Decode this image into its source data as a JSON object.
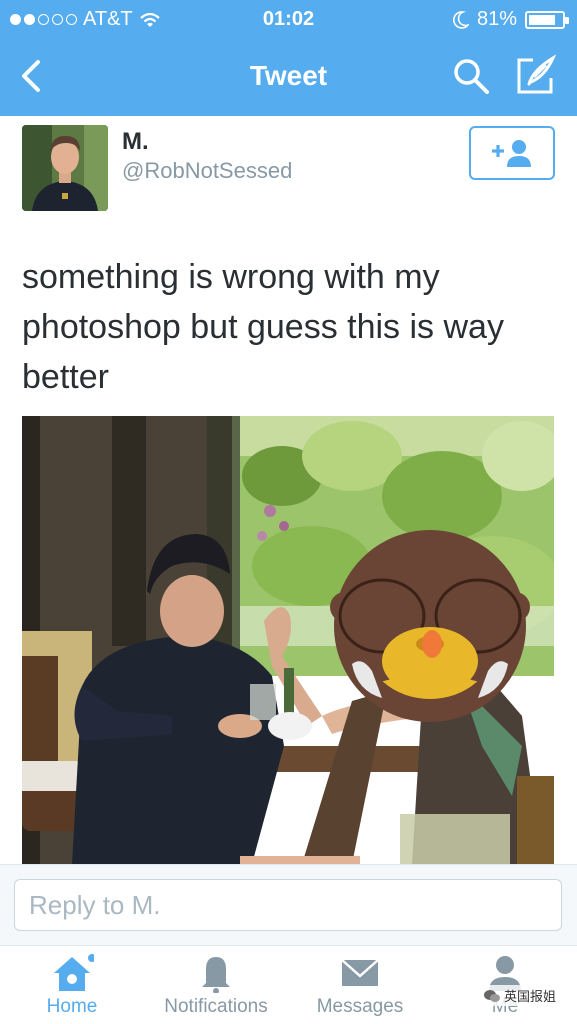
{
  "status_bar": {
    "carrier": "AT&T",
    "time": "01:02",
    "battery": "81%",
    "battery_level": 0.81,
    "signal_bars_full": 2,
    "signal_bars_total": 5
  },
  "nav": {
    "title": "Tweet",
    "icons": [
      "back-chevron-icon",
      "search-icon",
      "compose-icon"
    ]
  },
  "tweet": {
    "name": "M.",
    "handle": "@RobNotSessed",
    "text_line1": "something is wrong with my",
    "text_line2": "photoshop but guess this is way",
    "text_line3": "better"
  },
  "reply": {
    "placeholder": "Reply to M."
  },
  "tabs": [
    {
      "label": "Home",
      "icon": "home-icon",
      "active": true
    },
    {
      "label": "Notifications",
      "icon": "bell-icon",
      "active": false
    },
    {
      "label": "Messages",
      "icon": "envelope-icon",
      "active": false
    },
    {
      "label": "Me",
      "icon": "person-icon",
      "active": false
    }
  ],
  "watermark": "英国报姐",
  "colors": {
    "accent": "#55acee",
    "text": "#292f33",
    "muted": "#8899a6"
  }
}
